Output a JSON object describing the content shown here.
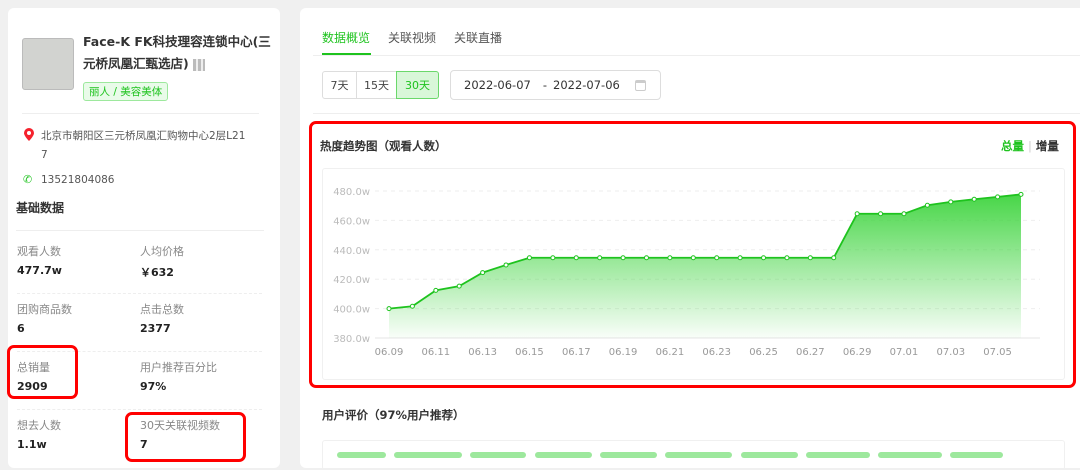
{
  "shop": {
    "name_line1": "Face-K FK科技理容连锁中心(三",
    "name_line2": "元桥凤凰汇甄选店)",
    "tag": "丽人 / 美容美体",
    "address_line1": "北京市朝阳区三元桥凤凰汇购物中心2层L21",
    "address_line2": "7",
    "phone": "13521804086"
  },
  "basic": {
    "title": "基础数据",
    "stats": [
      {
        "label": "观看人数",
        "value": "477.7w"
      },
      {
        "label": "人均价格",
        "value": "￥632"
      },
      {
        "label": "团购商品数",
        "value": "6"
      },
      {
        "label": "点击总数",
        "value": "2377"
      },
      {
        "label": "总销量",
        "value": "2909"
      },
      {
        "label": "用户推荐百分比",
        "value": "97%"
      },
      {
        "label": "想去人数",
        "value": "1.1w"
      },
      {
        "label": "30天关联视频数",
        "value": "7"
      }
    ]
  },
  "tabs": [
    {
      "label": "数据概览"
    },
    {
      "label": "关联视频"
    },
    {
      "label": "关联直播"
    }
  ],
  "ranges": [
    {
      "label": "7天"
    },
    {
      "label": "15天"
    },
    {
      "label": "30天"
    }
  ],
  "date_range": {
    "start": "2022-06-07",
    "sep": "-",
    "end": "2022-07-06"
  },
  "chart_toggle": {
    "total": "总量",
    "sep": "|",
    "incr": "增量"
  },
  "review": {
    "title": "用户评价（97%用户推荐）"
  },
  "colors": {
    "accent": "#1ec31e",
    "highlight": "#ff0000"
  },
  "chart_data": {
    "type": "area",
    "title": "热度趋势图（观看人数）",
    "x": [
      "06.09",
      "06.10",
      "06.11",
      "06.12",
      "06.13",
      "06.14",
      "06.15",
      "06.16",
      "06.17",
      "06.18",
      "06.19",
      "06.20",
      "06.21",
      "06.22",
      "06.23",
      "06.24",
      "06.25",
      "06.26",
      "06.27",
      "06.28",
      "06.29",
      "06.30",
      "07.01",
      "07.02",
      "07.03",
      "07.04",
      "07.05",
      "07.06"
    ],
    "values": [
      400,
      401.6,
      412.4,
      415.3,
      424.5,
      429.7,
      434.6,
      434.6,
      434.6,
      434.6,
      434.6,
      434.6,
      434.6,
      434.6,
      434.6,
      434.6,
      434.6,
      434.6,
      434.6,
      434.6,
      464.5,
      464.5,
      464.5,
      470.3,
      472.6,
      474.4,
      476,
      477.7
    ],
    "unit": "w",
    "yticks": [
      "380.0w",
      "400.0w",
      "420.0w",
      "440.0w",
      "460.0w",
      "480.0w"
    ],
    "ylim": [
      380,
      480
    ],
    "xtick_labels": [
      "06.09",
      "06.11",
      "06.13",
      "06.15",
      "06.17",
      "06.19",
      "06.21",
      "06.23",
      "06.25",
      "06.27",
      "06.29",
      "07.01",
      "07.03",
      "07.05"
    ],
    "grid": true
  }
}
